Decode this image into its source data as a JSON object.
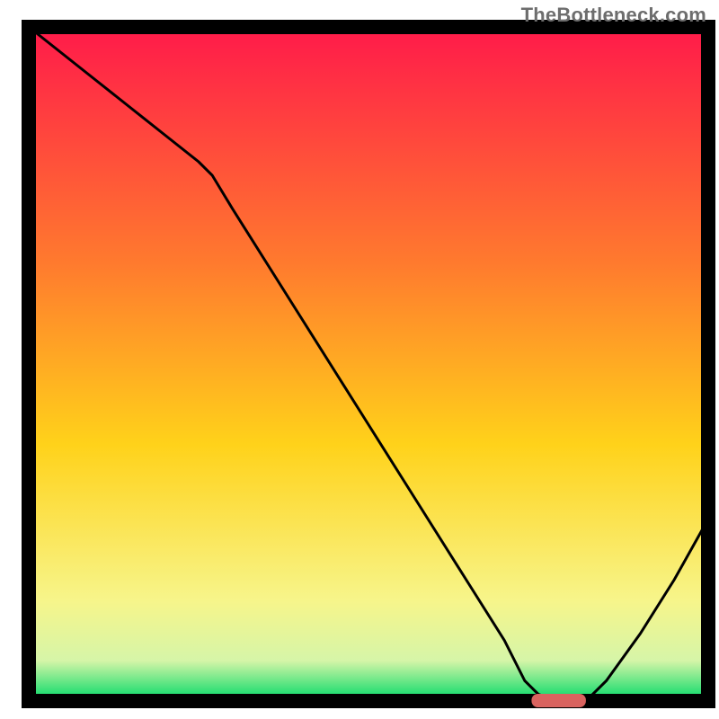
{
  "watermark": "TheBottleneck.com",
  "colors": {
    "axis": "#000000",
    "curve": "#000000",
    "marker_fill": "#d9635f",
    "gradient_top": "#ff1a4a",
    "gradient_upper_mid": "#ff7a2e",
    "gradient_mid": "#ffd21a",
    "gradient_lower_mid": "#f7f58a",
    "gradient_low": "#d6f5a8",
    "gradient_bottom": "#00d967"
  },
  "chart_data": {
    "type": "line",
    "title": "",
    "xlabel": "",
    "ylabel": "",
    "xlim": [
      0,
      100
    ],
    "ylim": [
      0,
      100
    ],
    "categories": [
      0,
      5,
      10,
      15,
      20,
      25,
      27,
      30,
      35,
      40,
      45,
      50,
      55,
      60,
      65,
      70,
      73,
      75,
      78,
      80,
      82,
      85,
      90,
      95,
      100
    ],
    "values": [
      100,
      96,
      92,
      88,
      84,
      80,
      78,
      73,
      65,
      57,
      49,
      41,
      33,
      25,
      17,
      9,
      3,
      1,
      0,
      0,
      0,
      3,
      10,
      18,
      27
    ],
    "marker": {
      "x_start": 74,
      "x_end": 82,
      "y": 0
    }
  }
}
